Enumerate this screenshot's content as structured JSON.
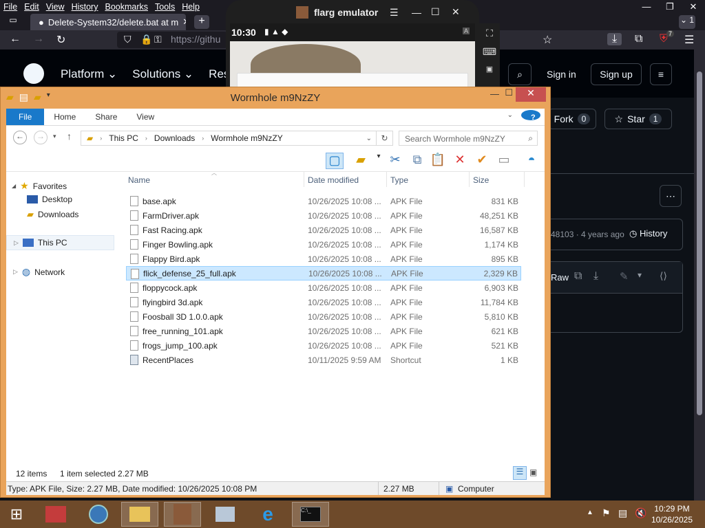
{
  "firefox": {
    "menu": [
      "File",
      "Edit",
      "View",
      "History",
      "Bookmarks",
      "Tools",
      "Help"
    ],
    "tab_title": "Delete-System32/delete.bat at m",
    "url": "https://githu",
    "badge_count": "7",
    "overflow_count": "1"
  },
  "github": {
    "nav": [
      "Platform",
      "Solutions",
      "Resou"
    ],
    "sign_in": "Sign in",
    "sign_up": "Sign up",
    "fork_label": "Fork",
    "fork_count": "0",
    "star_label": "Star",
    "star_count": "1",
    "commit_info": "48103 · 4 years ago",
    "history_label": "History",
    "raw_label": "Raw"
  },
  "emulator": {
    "title": "flarg emulator",
    "time": "10:30"
  },
  "explorer": {
    "title": "Wormhole m9NzZY",
    "ribbon_tabs": [
      "File",
      "Home",
      "Share",
      "View"
    ],
    "breadcrumb": [
      "This PC",
      "Downloads",
      "Wormhole m9NzZY"
    ],
    "search_placeholder": "Search Wormhole m9NzZY",
    "nav": {
      "favorites": "Favorites",
      "desktop": "Desktop",
      "downloads": "Downloads",
      "this_pc": "This PC",
      "network": "Network"
    },
    "columns": [
      "Name",
      "Date modified",
      "Type",
      "Size"
    ],
    "files": [
      {
        "name": "base.apk",
        "date": "10/26/2025 10:08 ...",
        "type": "APK File",
        "size": "831 KB"
      },
      {
        "name": "FarmDriver.apk",
        "date": "10/26/2025 10:08 ...",
        "type": "APK File",
        "size": "48,251 KB"
      },
      {
        "name": "Fast Racing.apk",
        "date": "10/26/2025 10:08 ...",
        "type": "APK File",
        "size": "16,587 KB"
      },
      {
        "name": "Finger Bowling.apk",
        "date": "10/26/2025 10:08 ...",
        "type": "APK File",
        "size": "1,174 KB"
      },
      {
        "name": "Flappy Bird.apk",
        "date": "10/26/2025 10:08 ...",
        "type": "APK File",
        "size": "895 KB"
      },
      {
        "name": "flick_defense_25_full.apk",
        "date": "10/26/2025 10:08 ...",
        "type": "APK File",
        "size": "2,329 KB"
      },
      {
        "name": "floppycock.apk",
        "date": "10/26/2025 10:08 ...",
        "type": "APK File",
        "size": "6,903 KB"
      },
      {
        "name": "flyingbird 3d.apk",
        "date": "10/26/2025 10:08 ...",
        "type": "APK File",
        "size": "11,784 KB"
      },
      {
        "name": "Foosball 3D 1.0.0.apk",
        "date": "10/26/2025 10:08 ...",
        "type": "APK File",
        "size": "5,810 KB"
      },
      {
        "name": "free_running_101.apk",
        "date": "10/26/2025 10:08 ...",
        "type": "APK File",
        "size": "621 KB"
      },
      {
        "name": "frogs_jump_100.apk",
        "date": "10/26/2025 10:08 ...",
        "type": "APK File",
        "size": "521 KB"
      },
      {
        "name": "RecentPlaces",
        "date": "10/11/2025 9:59 AM",
        "type": "Shortcut",
        "size": "1 KB"
      }
    ],
    "status_items": "12 items",
    "status_selected": "1 item selected  2.27 MB",
    "details_text": "Type: APK File, Size: 2.27 MB, Date modified: 10/26/2025 10:08 PM",
    "details_size": "2.27 MB",
    "details_location": "Computer"
  },
  "taskbar": {
    "time": "10:29 PM",
    "date": "10/26/2025"
  }
}
